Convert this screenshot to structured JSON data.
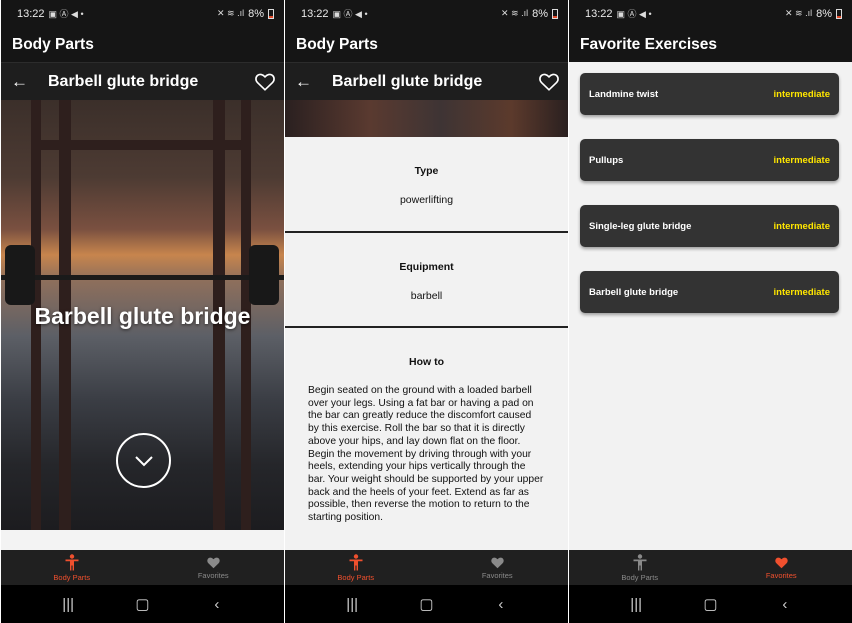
{
  "status": {
    "time": "13:22",
    "battery": "8%"
  },
  "colors": {
    "accent": "#f0502e",
    "level": "#ffe600",
    "card": "#333333",
    "bar": "#151515"
  },
  "screen1": {
    "app_title": "Body Parts",
    "detail_title": "Barbell glute bridge",
    "hero_title": "Barbell glute bridge"
  },
  "screen2": {
    "app_title": "Body Parts",
    "detail_title": "Barbell glute bridge",
    "type_label": "Type",
    "type_value": "powerlifting",
    "equipment_label": "Equipment",
    "equipment_value": "barbell",
    "howto_label": "How to",
    "howto_text": "Begin seated on the ground with a loaded barbell over your legs. Using a fat bar or having a pad on the bar can greatly reduce the discomfort caused by this exercise. Roll the bar so that it is directly above your hips, and lay down flat on the floor. Begin the movement by driving through with your heels, extending your hips vertically through the bar. Your weight should be supported by your upper back and the heels of your feet. Extend as far as possible, then reverse the motion to return to the starting position."
  },
  "screen3": {
    "app_title": "Favorite Exercises",
    "favorites": [
      {
        "name": "Landmine twist",
        "level": "intermediate"
      },
      {
        "name": "Pullups",
        "level": "intermediate"
      },
      {
        "name": "Single-leg glute bridge",
        "level": "intermediate"
      },
      {
        "name": "Barbell glute bridge",
        "level": "intermediate"
      }
    ]
  },
  "nav": {
    "body_parts": "Body Parts",
    "favorites": "Favorites"
  },
  "icons": [
    "back-arrow-icon",
    "heart-outline-icon",
    "chevron-down-icon",
    "person-icon",
    "heart-icon",
    "recents-icon",
    "home-icon",
    "back-icon"
  ]
}
